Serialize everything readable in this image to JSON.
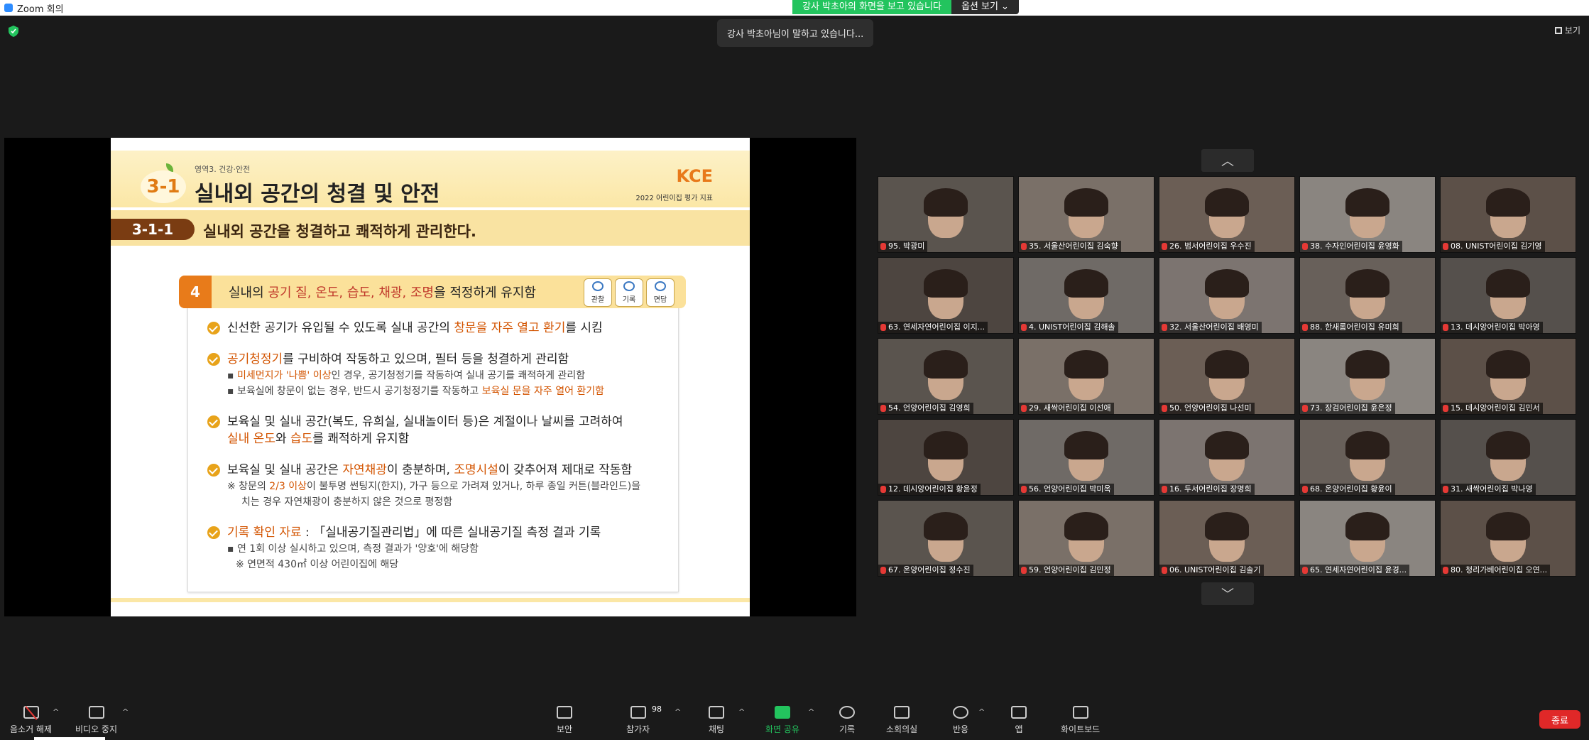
{
  "window": {
    "title": "Zoom 회의"
  },
  "banner": {
    "message": "강사 박초아의 화면을 보고 있습니다",
    "options": "옵션 보기 ⌄"
  },
  "speaking": "강사 박초아님이 말하고 있습니다...",
  "view": {
    "label": "보기"
  },
  "slide": {
    "area_tag": "영역3. 건강·안전",
    "badge": "3-1",
    "title": "실내외 공간의 청결 및 안전",
    "logo": "KCE",
    "logo_sub": "2022 어린이집 평가 지표",
    "sub_code": "3-1-1",
    "sub_title": "실내외 공간을 청결하고 쾌적하게 관리한다.",
    "indicator_num": "4",
    "indicator_pre": "실내의 ",
    "indicator_hl": "공기 질, 온도, 습도, 채광, 조명",
    "indicator_post": "을 적정하게 유지함",
    "mini": [
      "관찰",
      "기록",
      "면담"
    ],
    "items": {
      "i1_a": "신선한 공기가 유입될 수 있도록 실내 공간의 ",
      "i1_hl": "창문을 자주 열고 환기",
      "i1_b": "를 시킴",
      "i2_hl": "공기청정기",
      "i2_b": "를 구비하여 작동하고 있으며, 필터 등을 청결하게 관리함",
      "i2_s1_hl": "미세먼지가 '나쁨' 이상",
      "i2_s1_b": "인 경우, 공기청정기를 작동하여 실내 공기를 쾌적하게 관리함",
      "i2_s2_a": "보육실에 창문이 없는 경우, 반드시 공기청정기를 작동하고 ",
      "i2_s2_hl": "보육실 문을 자주 열어 환기함",
      "i3_a": "보육실 및 실내 공간(복도, 유희실, 실내놀이터 등)은 계절이나 날씨를 고려하여",
      "i3_hl1": "실내 온도",
      "i3_mid": "와 ",
      "i3_hl2": "습도",
      "i3_b": "를 쾌적하게 유지함",
      "i4_a": "보육실 및 실내 공간은 ",
      "i4_hl1": "자연채광",
      "i4_mid": "이 충분하며, ",
      "i4_hl2": "조명시설",
      "i4_b": "이 갖추어져 제대로 작동함",
      "i4_note_a": "※ 창문의 ",
      "i4_note_hl": "2/3 이상",
      "i4_note_b": "이 불투명 썬팅지(한지), 가구 등으로 가려져 있거나, 하루 종일 커튼(블라인드)을",
      "i4_note_c": "치는 경우 자연채광이 충분하지 않은 것으로 평정함",
      "i5_hl": "기록 확인 자료",
      "i5_b": " : 「실내공기질관리법」에 따른 실내공기질 측정 결과 기록",
      "i5_s1": "연 1회 이상 실시하고 있으며, 측정 결과가 '양호'에 해당함",
      "i5_s2": "※  연면적 430㎡ 이상 어린이집에 해당"
    }
  },
  "participants": [
    "95. 박광미",
    "35. 서울산어린이집 김숙향",
    "26. 범서어린이집 우수진",
    "38. 수자인어린이집 윤영화",
    "08. UNIST어린이집 김기영",
    "63. 연세자연어린이집 이지...",
    "4. UNIST어린이집 김해솔",
    "32. 서울산어린이집 배영미",
    "88. 한새롬어린이집 유미희",
    "13. 데시앙어린이집 박아영",
    "54. 언양어린이집 김영희",
    "29. 새싹어린이집 이선애",
    "50. 언양어린이집 나선미",
    "73. 장검어린이집 윤은정",
    "15. 데시앙어린이집 김민서",
    "12. 데시앙어린이집 황윤정",
    "56. 언양어린이집 박미옥",
    "16. 두서어린이집 장명희",
    "68. 온양어린이집 황윤이",
    "31. 새싹어린이집 박나영",
    "67. 온양어린이집 정수진",
    "59. 언양어린이집 김민정",
    "06. UNIST어린이집 김솔기",
    "65. 연세자연어린이집 윤경...",
    "80. 청리가베어린이집 오연..."
  ],
  "toolbar": {
    "mute": "음소거 해제",
    "video": "비디오 중지",
    "security": "보안",
    "participants": "참가자",
    "participant_count": "98",
    "chat": "채팅",
    "share": "화면 공유",
    "record": "기록",
    "breakout": "소회의실",
    "reactions": "반응",
    "apps": "앱",
    "whiteboard": "화이트보드",
    "end": "종료"
  }
}
